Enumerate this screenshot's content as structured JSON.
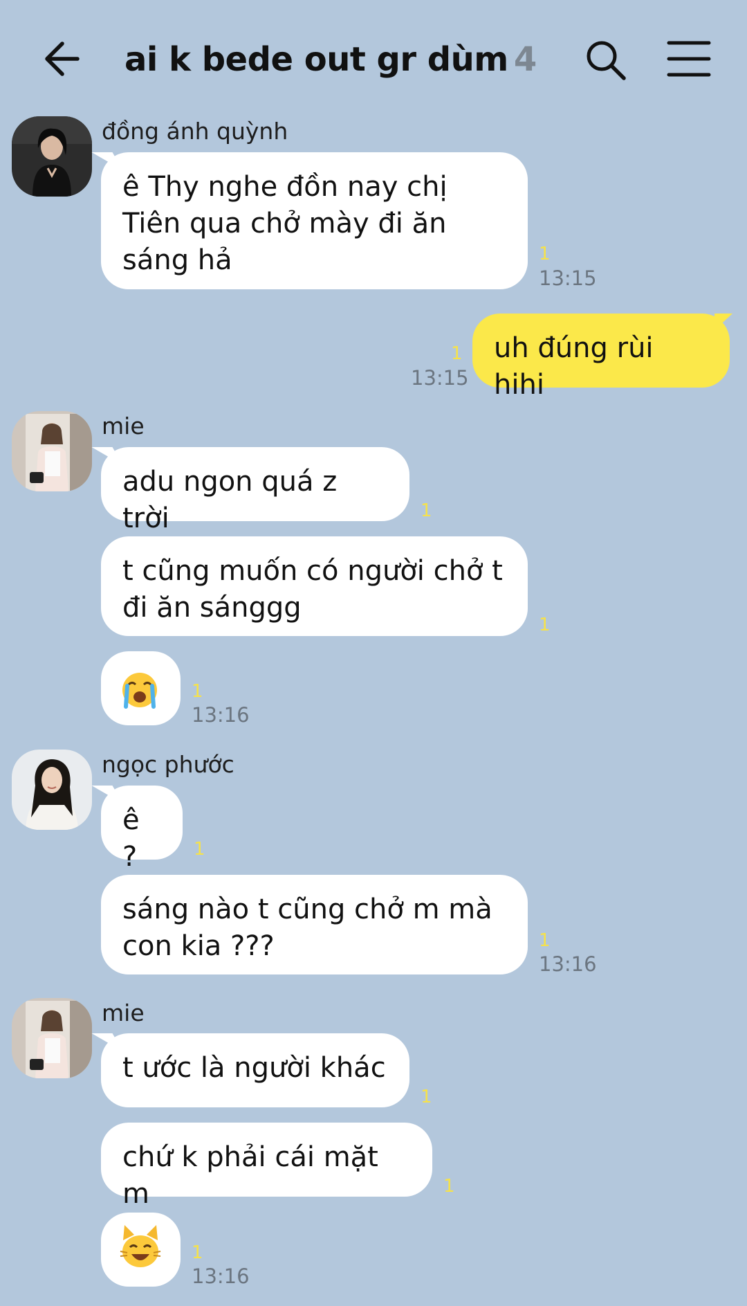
{
  "header": {
    "title": "ai k bede out gr dùm",
    "member_count": "4",
    "back_icon": "arrow-left-icon",
    "search_icon": "search-icon",
    "menu_icon": "hamburger-menu-icon"
  },
  "colors": {
    "background": "#b3c7dc",
    "own_bubble": "#fbe84a",
    "other_bubble": "#ffffff",
    "unread_count": "#f6e24a"
  },
  "messages": [
    {
      "sender": "đồng ánh quỳnh",
      "text": "ê Thy nghe đồn nay chị\nTiên qua chở mày đi ăn\nsáng hả",
      "unread": "1",
      "time": "13:15"
    },
    {
      "sender": "me",
      "text": "uh đúng rùi hihi",
      "unread": "1",
      "time": "13:15"
    },
    {
      "sender": "mie",
      "text": "adu ngon quá z trời",
      "unread": "1"
    },
    {
      "sender": "mie",
      "text": "t cũng muốn có người chở t\nđi ăn sánggg",
      "unread": "1"
    },
    {
      "sender": "mie",
      "emoji": "😭",
      "emoji_name": "loudly-crying-face-emoji",
      "unread": "1",
      "time": "13:16"
    },
    {
      "sender": "ngọc phước",
      "text": "ê ?",
      "unread": "1"
    },
    {
      "sender": "ngọc phước",
      "text": "sáng nào t cũng chở m mà\ncon kia ???",
      "unread": "1",
      "time": "13:16"
    },
    {
      "sender": "mie",
      "text": "t ước là người khác",
      "unread": "1"
    },
    {
      "sender": "mie",
      "text": "chứ k phải cái mặt m",
      "unread": "1"
    },
    {
      "sender": "mie",
      "emoji": "😸",
      "emoji_name": "grinning-cat-emoji",
      "unread": "1",
      "time": "13:16"
    }
  ]
}
